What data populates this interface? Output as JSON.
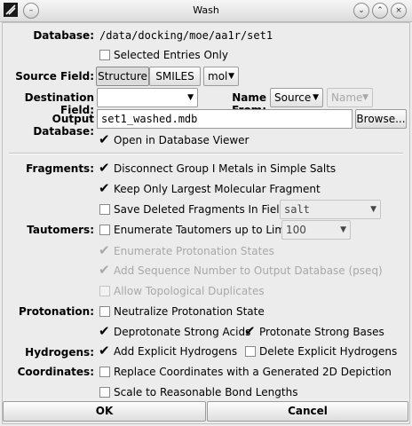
{
  "window": {
    "title": "Wash"
  },
  "database": {
    "label": "Database:",
    "path": "/data/docking/moe/aa1r/set1"
  },
  "selected_entries": {
    "label": "Selected Entries Only",
    "checked": false
  },
  "source_field": {
    "label": "Source Field:",
    "structure": "Structure",
    "smiles": "SMILES",
    "value": "mol"
  },
  "destination": {
    "label": "Destination Field:",
    "value": "",
    "name_from_label": "Name From:",
    "name_from_value": "Source",
    "name_value": "Name"
  },
  "output": {
    "label": "Output Database:",
    "value": "set1_washed.mdb",
    "browse": "Browse..."
  },
  "open_viewer": {
    "label": "Open in Database Viewer",
    "checked": true
  },
  "fragments": {
    "label": "Fragments:",
    "disconnect": "Disconnect Group I Metals in Simple Salts",
    "keep_largest": "Keep Only Largest Molecular Fragment",
    "save_deleted": "Save Deleted Fragments In Field:",
    "save_field_value": "salt"
  },
  "tautomers": {
    "label": "Tautomers:",
    "enumerate": "Enumerate Tautomers up to Limit:",
    "limit": "100",
    "protonation_states": "Enumerate Protonation States",
    "sequence": "Add Sequence Number to Output Database (pseq)",
    "topological": "Allow Topological Duplicates"
  },
  "protonation": {
    "label": "Protonation:",
    "neutralize": "Neutralize Protonation State",
    "deprotonate": "Deprotonate Strong Acids",
    "protonate": "Protonate Strong Bases"
  },
  "hydrogens": {
    "label": "Hydrogens:",
    "add": "Add Explicit Hydrogens",
    "delete": "Delete Explicit Hydrogens"
  },
  "coordinates": {
    "label": "Coordinates:",
    "replace": "Replace Coordinates with a Generated 2D Depiction",
    "scale": "Scale to Reasonable Bond Lengths"
  },
  "buttons": {
    "ok": "OK",
    "cancel": "Cancel"
  },
  "icons": {
    "app": "moe-app-icon",
    "menu": "window-menu-icon",
    "minimize": "chevron-down-icon",
    "maximize": "chevron-up-icon",
    "close": "close-icon",
    "check": "check-mark",
    "dropdown": "dropdown-arrow-icon"
  }
}
